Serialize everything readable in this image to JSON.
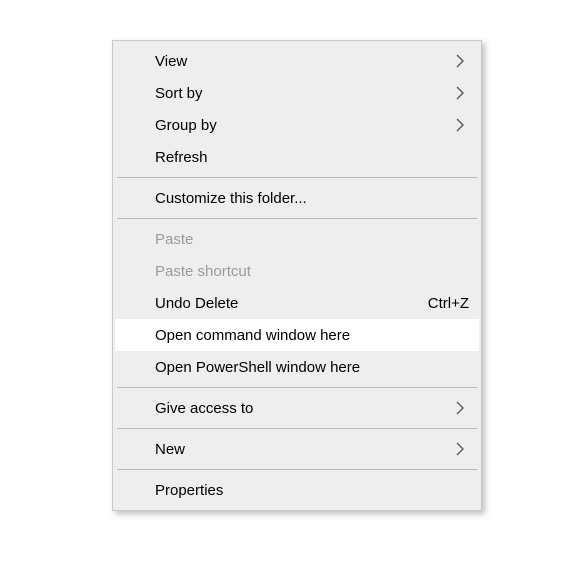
{
  "menu": {
    "view": {
      "label": "View",
      "submenu": true
    },
    "sort_by": {
      "label": "Sort by",
      "submenu": true
    },
    "group_by": {
      "label": "Group by",
      "submenu": true
    },
    "refresh": {
      "label": "Refresh"
    },
    "customize": {
      "label": "Customize this folder..."
    },
    "paste": {
      "label": "Paste",
      "disabled": true
    },
    "paste_shortcut": {
      "label": "Paste shortcut",
      "disabled": true
    },
    "undo_delete": {
      "label": "Undo Delete",
      "shortcut": "Ctrl+Z"
    },
    "open_cmd": {
      "label": "Open command window here",
      "hovered": true
    },
    "open_powershell": {
      "label": "Open PowerShell window here"
    },
    "give_access": {
      "label": "Give access to",
      "submenu": true
    },
    "new": {
      "label": "New",
      "submenu": true
    },
    "properties": {
      "label": "Properties"
    }
  }
}
